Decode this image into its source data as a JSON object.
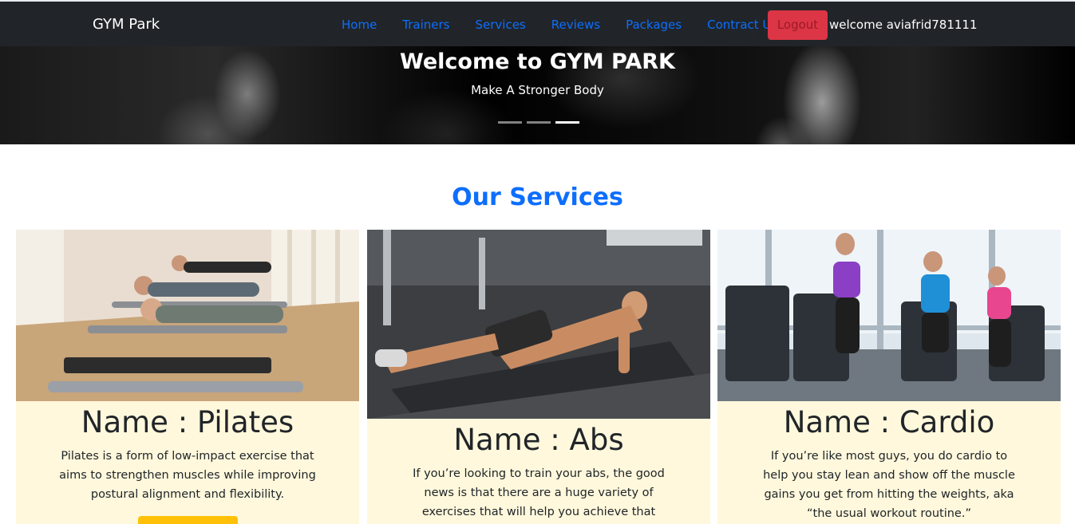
{
  "navbar": {
    "brand": "GYM Park",
    "links": [
      "Home",
      "Trainers",
      "Services",
      "Reviews",
      "Packages",
      "Contract US"
    ],
    "logout_label": "Logout",
    "welcome_text": "welcome aviafrid781111"
  },
  "hero": {
    "title": "Welcome to GYM PARK",
    "subtitle": "Make A Stronger Body",
    "slides": 3,
    "active_slide": 3
  },
  "services": {
    "title": "Our Services",
    "cards": [
      {
        "name": "Name : Pilates",
        "description": "Pilates is a form of low-impact exercise that aims to strengthen muscles while improving postural alignment and flexibility."
      },
      {
        "name": "Name : Abs",
        "description": "If you’re looking to train your abs, the good news is that there are a huge variety of exercises that will help you achieve that goal."
      },
      {
        "name": "Name : Cardio",
        "description": "If you’re like most guys, you do cardio to help you stay lean and show off the muscle gains you get from hitting the weights, aka “the usual workout routine.”"
      }
    ]
  },
  "colors": {
    "navbar_bg": "#212529",
    "link": "#0d6efd",
    "logout": "#dc3545",
    "card_bg": "#fff8dc",
    "card_button": "#ffc107"
  }
}
